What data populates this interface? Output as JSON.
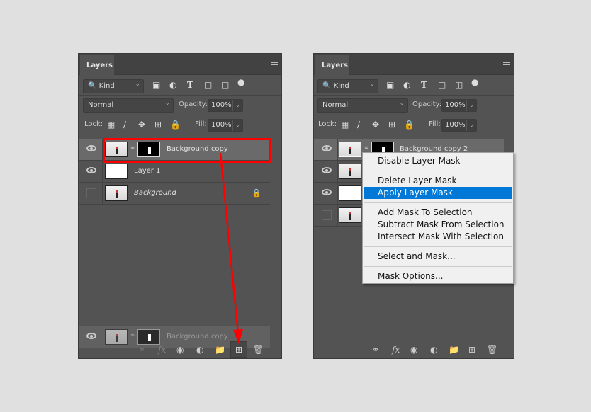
{
  "panel_tab": "Layers",
  "filter": {
    "kind": "Kind"
  },
  "blend_mode": "Normal",
  "opacity_label": "Opacity:",
  "opacity": "100%",
  "lock_label": "Lock:",
  "fill_label": "Fill:",
  "fill": "100%",
  "left_layers": [
    {
      "name": "Background copy",
      "visible": true,
      "selected": true
    },
    {
      "name": "Layer 1",
      "visible": true
    },
    {
      "name": "Background",
      "visible": false,
      "locked": true
    }
  ],
  "drag_ghost": {
    "name": "Background copy"
  },
  "right_layers": [
    {
      "name": "Background copy 2",
      "visible": true,
      "selected": true
    }
  ],
  "context_menu": [
    "Disable Layer Mask",
    "Delete Layer Mask",
    "Apply Layer Mask",
    "Add Mask To Selection",
    "Subtract Mask From Selection",
    "Intersect Mask With Selection",
    "Select and Mask...",
    "Mask Options..."
  ],
  "highlight_color": "#0078d7",
  "annotation_color": "#ff0000"
}
